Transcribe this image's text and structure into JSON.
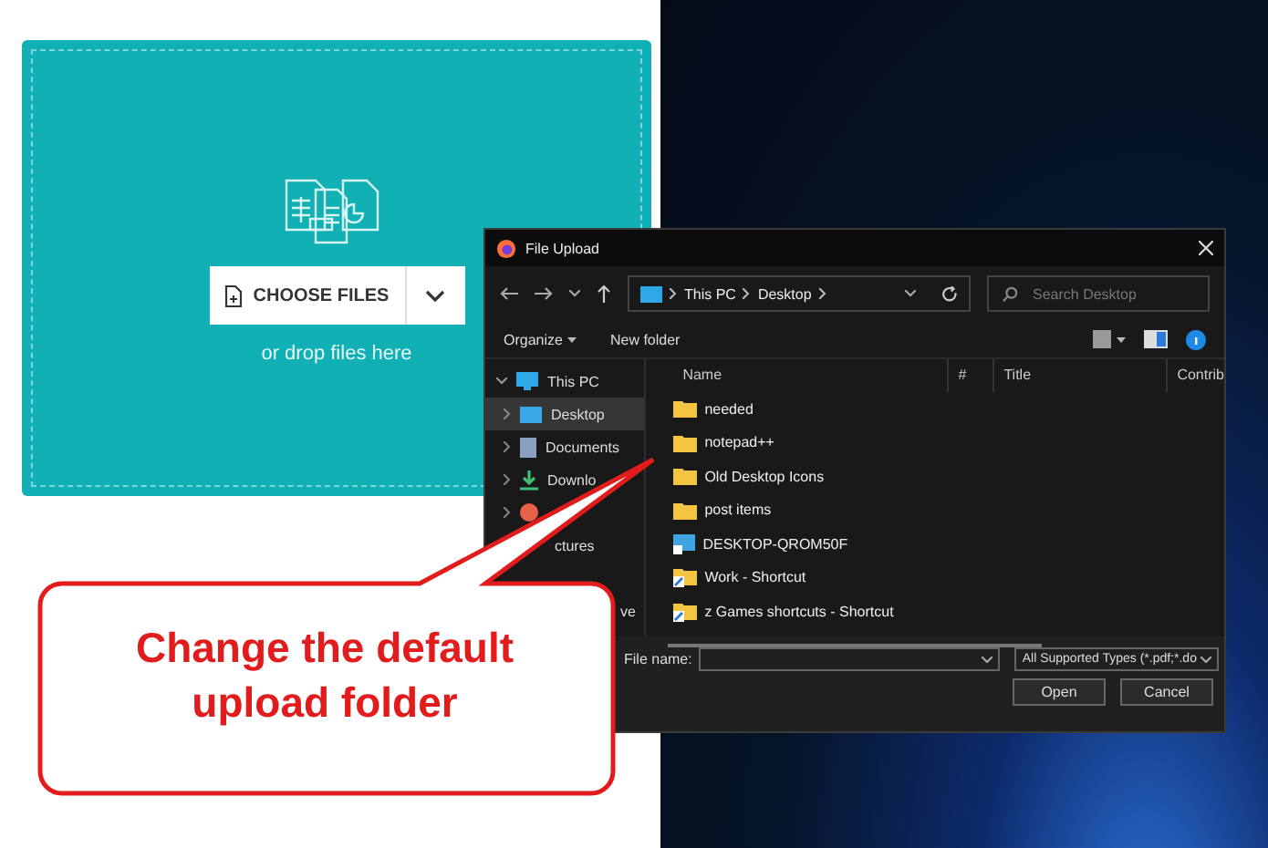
{
  "upload_card": {
    "button": "CHOOSE FILES",
    "hint": "or drop files here"
  },
  "dialog": {
    "title": "File Upload",
    "breadcrumb": [
      "This PC",
      "Desktop"
    ],
    "search": {
      "placeholder": "Search Desktop"
    },
    "toolbar": [
      "Organize",
      "New folder"
    ],
    "sidebar": [
      {
        "label": "This PC",
        "kind": "pc",
        "expanded": true,
        "selected": false,
        "children": [
          {
            "label": "Desktop",
            "kind": "desktop",
            "selected": true
          },
          {
            "label": "Documents",
            "kind": "documents",
            "selected": false
          },
          {
            "label": "Downlo",
            "kind": "downloads",
            "selected": false
          },
          {
            "kind": "pictures",
            "selected": false
          },
          {
            "label": "ctures",
            "kind": "cut",
            "selected": false
          },
          {
            "kind": "covered",
            "selected": false
          },
          {
            "label": "ve",
            "kind": "cut",
            "selected": false
          }
        ]
      }
    ],
    "columns": [
      "Name",
      "#",
      "Title",
      "Contrib"
    ],
    "files": [
      {
        "name": "needed",
        "kind": "folder"
      },
      {
        "name": "notepad++",
        "kind": "folder"
      },
      {
        "name": "Old Desktop Icons",
        "kind": "folder"
      },
      {
        "name": "post items",
        "kind": "folder"
      },
      {
        "name": "DESKTOP-QROM50F",
        "kind": "computer"
      },
      {
        "name": "Work - Shortcut",
        "kind": "shortcut"
      },
      {
        "name": "z Games shortcuts - Shortcut",
        "kind": "shortcut"
      }
    ],
    "file_name": {
      "label": "File name:"
    },
    "file_type": "All Supported Types (*.pdf;*.do",
    "buttons": [
      "Open",
      "Cancel"
    ]
  },
  "callout": "Change the default upload folder"
}
